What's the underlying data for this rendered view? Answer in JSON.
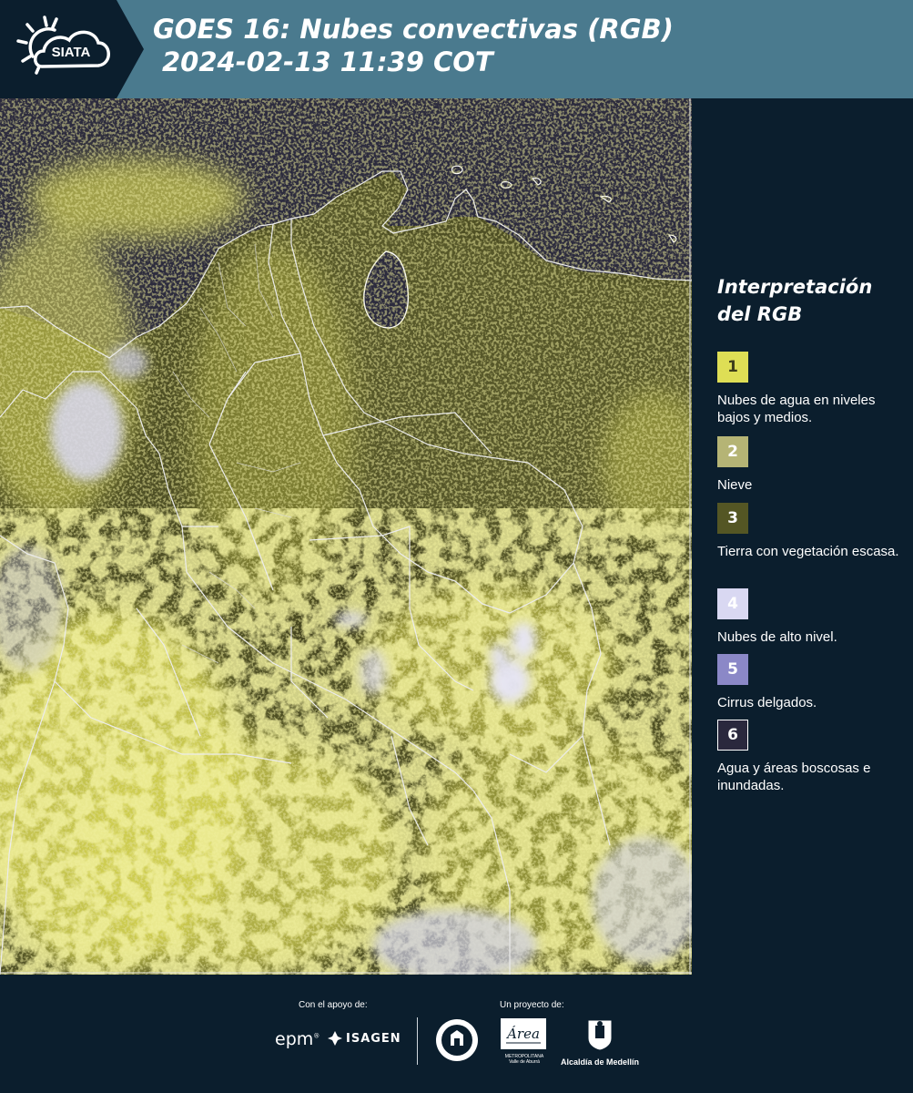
{
  "header": {
    "title_line1": "GOES 16: Nubes convectivas (RGB)",
    "title_line2": "2024-02-13 11:39 COT",
    "logo_text": "SIATA"
  },
  "legend": {
    "title": "Interpretación del RGB",
    "items": [
      {
        "number": "1",
        "label": "Nubes de agua en niveles bajos y medios.",
        "color": "#dede55",
        "text_color": "#3d3d1a"
      },
      {
        "number": "2",
        "label": "Nieve",
        "color": "#b5b475",
        "text_color": "#ffffff"
      },
      {
        "number": "3",
        "label": "Tierra con vegetación escasa.",
        "color": "#545624",
        "text_color": "#ffffff"
      },
      {
        "number": "4",
        "label": "Nubes de alto nivel.",
        "color": "#d9d8f2",
        "text_color": "#ffffff"
      },
      {
        "number": "5",
        "label": "Cirrus delgados.",
        "color": "#8b88c7",
        "text_color": "#ffffff"
      },
      {
        "number": "6",
        "label": "Agua y áreas boscosas e inundadas.",
        "color": "#2a283d",
        "text_color": "#ffffff"
      }
    ]
  },
  "footer": {
    "support_label": "Con el apoyo de:",
    "project_label": "Un proyecto de:",
    "epm_text": "epm",
    "isagen_text": "ISAGEN",
    "amva_text": "Área",
    "amva_subtext": "METROPOLITANA Valle de Aburrá",
    "alcaldia_text": "Alcaldía de Medellín"
  },
  "colors": {
    "header_bg": "#4a7a8e",
    "logo_bg": "#0b1e2d",
    "panel_bg": "#0b1e2d",
    "ocean": "#2c2b3d",
    "land": "#4e4f24",
    "low_cloud": "#e2e158",
    "high_cloud": "#d8d7ee",
    "border": "#e8e8e8"
  }
}
